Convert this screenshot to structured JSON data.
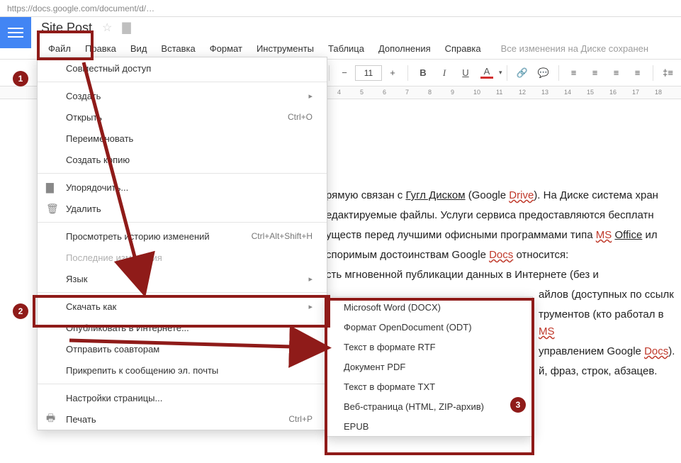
{
  "url_placeholder": "https://docs.google.com/document/d/…",
  "doc_title": "Site Post",
  "menubar": [
    "Файл",
    "Правка",
    "Вид",
    "Вставка",
    "Формат",
    "Инструменты",
    "Таблица",
    "Дополнения",
    "Справка"
  ],
  "changes": "Все изменения на Диске сохранен",
  "toolbar": {
    "font_size": "11",
    "bold": "B",
    "italic": "I",
    "underline": "U",
    "color": "A"
  },
  "ruler_marks": [
    "4",
    "5",
    "6",
    "7",
    "8",
    "9",
    "10",
    "11",
    "12",
    "13",
    "14",
    "15",
    "16",
    "17",
    "18"
  ],
  "dropdown": {
    "share": "Совместный доступ",
    "new": "Создать",
    "open": "Открыть",
    "open_sc": "Ctrl+O",
    "rename": "Переименовать",
    "makecopy": "Создать копию",
    "organize": "Упорядочить...",
    "delete": "Удалить",
    "history": "Просмотреть историю изменений",
    "history_sc": "Ctrl+Alt+Shift+H",
    "recent": "Последние изменения",
    "language": "Язык",
    "download": "Скачать как",
    "publish": "Опубликовать в Интернете...",
    "email": "Отправить соавторам",
    "attach": "Прикрепить к сообщению эл. почты",
    "pagesetup": "Настройки страницы...",
    "print": "Печать",
    "print_sc": "Ctrl+P"
  },
  "submenu": [
    "Microsoft Word (DOCX)",
    "Формат OpenDocument (ODT)",
    "Текст в формате RTF",
    "Документ PDF",
    "Текст в формате TXT",
    "Веб-страница (HTML, ZIP-архив)",
    "EPUB"
  ],
  "body": {
    "l1a": "рямую связан с ",
    "l1link": "Гугл Диском",
    "l1b": " (Google ",
    "l1drive": "Drive",
    "l1c": "). На Диске система хран",
    "l2": "едактируемые файлы. Услуги сервиса предоставляются бесплатн",
    "l3a": "уществ перед лучшими офисными программами типа ",
    "l3ms": "MS",
    "l3sp": " ",
    "l3office": "Office",
    "l3b": " ил",
    "l4a": "споримым достоинствам Google ",
    "l4docs": "Docs",
    "l4b": " относится:",
    "l5": "сть мгновенной публикации данных в Интернете (без и",
    "l6": "айлов (доступных по ссылк",
    "l7a": "трументов (кто работал в ",
    "l7ms": "MS",
    "l8a": "управлением Google ",
    "l8docs": "Docs",
    "l8b": ").",
    "l9": "й, фраз, строк, абзацев."
  },
  "badges": {
    "1": "1",
    "2": "2",
    "3": "3"
  }
}
